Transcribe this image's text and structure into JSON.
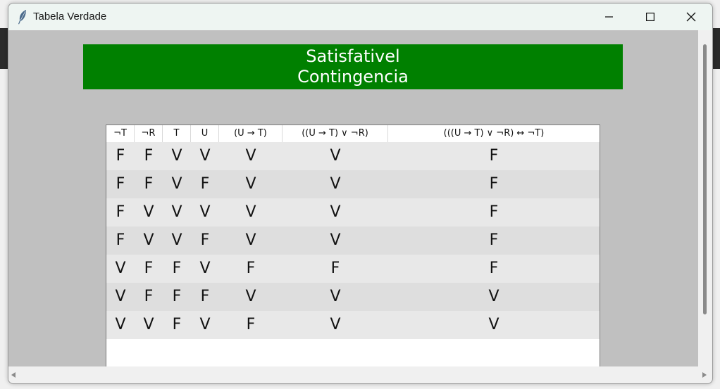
{
  "window": {
    "title": "Tabela Verdade",
    "icon": "feather-icon"
  },
  "banner": {
    "line1": "Satisfativel",
    "line2": "Contingencia",
    "color": "#008000"
  },
  "table": {
    "headers": [
      "¬T",
      "¬R",
      "T",
      "U",
      "(U → T)",
      "((U → T) ∨ ¬R)",
      "(((U → T) ∨ ¬R) ↔ ¬T)"
    ],
    "rows": [
      [
        "F",
        "F",
        "V",
        "V",
        "V",
        "V",
        "F"
      ],
      [
        "F",
        "F",
        "V",
        "F",
        "V",
        "V",
        "F"
      ],
      [
        "F",
        "V",
        "V",
        "V",
        "V",
        "V",
        "F"
      ],
      [
        "F",
        "V",
        "V",
        "F",
        "V",
        "V",
        "F"
      ],
      [
        "V",
        "F",
        "F",
        "V",
        "F",
        "F",
        "F"
      ],
      [
        "V",
        "F",
        "F",
        "F",
        "V",
        "V",
        "V"
      ],
      [
        "V",
        "V",
        "F",
        "V",
        "F",
        "V",
        "V"
      ]
    ]
  }
}
